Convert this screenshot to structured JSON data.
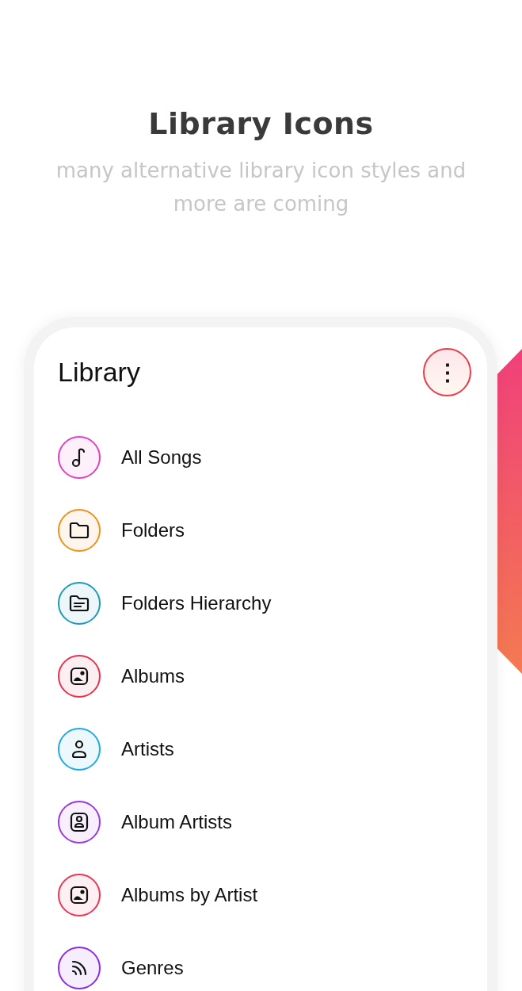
{
  "header": {
    "title": "Library Icons",
    "subtitle": "many alternative library icon styles and more are coming"
  },
  "screen": {
    "title": "Library",
    "menu_button": {
      "label": "⋮",
      "color": "#ec3a4a"
    },
    "items": [
      {
        "label": "All Songs",
        "kind": "note",
        "color": "#e040c0"
      },
      {
        "label": "Folders",
        "kind": "folder",
        "color": "#f0901c"
      },
      {
        "label": "Folders Hierarchy",
        "kind": "folder-lines",
        "color": "#1c9ab8"
      },
      {
        "label": "Albums",
        "kind": "picture-frame",
        "color": "#e8304e"
      },
      {
        "label": "Artists",
        "kind": "person",
        "color": "#1ea8e8"
      },
      {
        "label": "Album Artists",
        "kind": "person-frame",
        "color": "#9a3ad8"
      },
      {
        "label": "Albums by Artist",
        "kind": "picture-frame",
        "color": "#ec3454"
      },
      {
        "label": "Genres",
        "kind": "waves",
        "color": "#8a2be2"
      }
    ]
  }
}
